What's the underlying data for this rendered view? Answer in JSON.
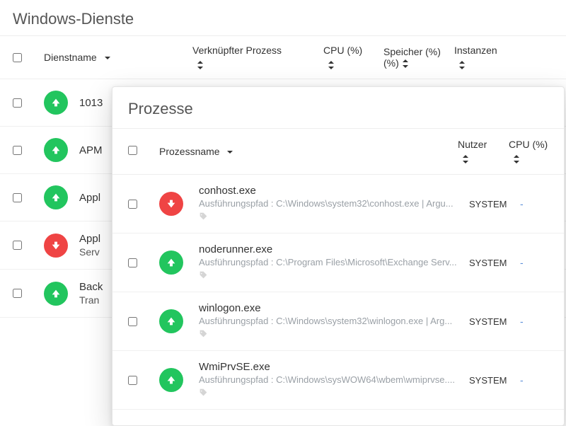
{
  "services": {
    "title": "Windows-Dienste",
    "columns": {
      "name": "Dienstname",
      "linked_process": "Verknüpfter Prozess",
      "cpu": "CPU (%)",
      "memory": "Speicher (%)",
      "instances": "Instanzen"
    },
    "rows": [
      {
        "status": "up",
        "name": "1013",
        "sub": ""
      },
      {
        "status": "up",
        "name": "APM",
        "sub": ""
      },
      {
        "status": "up",
        "name": "Appl",
        "sub": ""
      },
      {
        "status": "down",
        "name": "Appl",
        "sub": "Serv"
      },
      {
        "status": "up",
        "name": "Back",
        "sub": "Tran"
      }
    ]
  },
  "processes": {
    "title": "Prozesse",
    "columns": {
      "name": "Prozessname",
      "user": "Nutzer",
      "cpu": "CPU (%)"
    },
    "path_prefix": "Ausführungspfad : ",
    "rows": [
      {
        "status": "down",
        "name": "conhost.exe",
        "path": "C:\\Windows\\system32\\conhost.exe | Argu...",
        "user": "SYSTEM",
        "cpu": "-"
      },
      {
        "status": "up",
        "name": "noderunner.exe",
        "path": "C:\\Program Files\\Microsoft\\Exchange Serv...",
        "user": "SYSTEM",
        "cpu": "-"
      },
      {
        "status": "up",
        "name": "winlogon.exe",
        "path": "C:\\Windows\\system32\\winlogon.exe | Arg...",
        "user": "SYSTEM",
        "cpu": "-"
      },
      {
        "status": "up",
        "name": "WmiPrvSE.exe",
        "path": "C:\\Windows\\sysWOW64\\wbem\\wmiprvse....",
        "user": "SYSTEM",
        "cpu": "-"
      }
    ]
  }
}
